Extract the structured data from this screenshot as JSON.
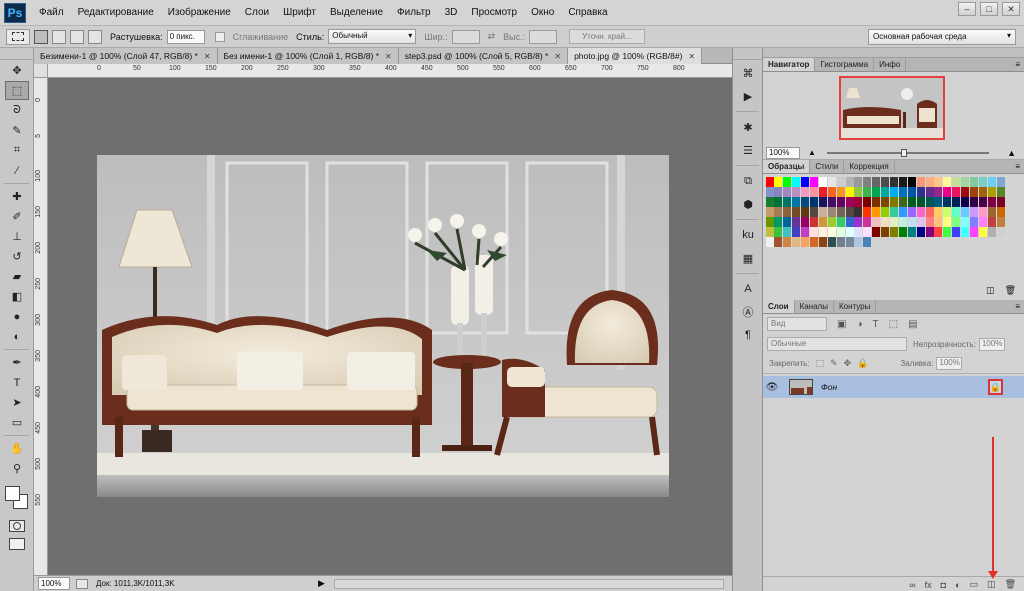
{
  "app": {
    "logo": "Ps"
  },
  "menu": [
    "Файл",
    "Редактирование",
    "Изображение",
    "Слои",
    "Шрифт",
    "Выделение",
    "Фильтр",
    "3D",
    "Просмотр",
    "Окно",
    "Справка"
  ],
  "window_controls": {
    "minimize": "–",
    "maximize": "□",
    "close": "✕"
  },
  "options": {
    "feather_label": "Растушевка:",
    "feather_value": "0 пикс.",
    "antialias_label": "Сглаживание",
    "style_label": "Стиль:",
    "style_value": "Обычный",
    "width_label": "Шир.:",
    "height_label": "Выс.:",
    "swap_icon": "⇄",
    "refine_label": "Уточн. край...",
    "workspace": "Основная рабочая среда"
  },
  "tools": [
    {
      "name": "move-icon",
      "glyph": "✥"
    },
    {
      "name": "marquee-icon",
      "glyph": "⬚"
    },
    {
      "name": "lasso-icon",
      "glyph": "ᘐ"
    },
    {
      "name": "quick-select-icon",
      "glyph": "✎"
    },
    {
      "name": "crop-icon",
      "glyph": "⌗"
    },
    {
      "name": "eyedropper-icon",
      "glyph": "⁄"
    },
    {
      "name": "healing-icon",
      "glyph": "✚"
    },
    {
      "name": "brush-icon",
      "glyph": "✐"
    },
    {
      "name": "stamp-icon",
      "glyph": "⊥"
    },
    {
      "name": "history-brush-icon",
      "glyph": "↺"
    },
    {
      "name": "eraser-icon",
      "glyph": "▰"
    },
    {
      "name": "gradient-icon",
      "glyph": "◧"
    },
    {
      "name": "blur-icon",
      "glyph": "●"
    },
    {
      "name": "dodge-icon",
      "glyph": "◐"
    },
    {
      "name": "pen-icon",
      "glyph": "✒"
    },
    {
      "name": "type-icon",
      "glyph": "T"
    },
    {
      "name": "path-select-icon",
      "glyph": "➤"
    },
    {
      "name": "shape-icon",
      "glyph": "▭"
    },
    {
      "name": "hand-icon",
      "glyph": "✋"
    },
    {
      "name": "zoom-icon",
      "glyph": "⚲"
    }
  ],
  "tabs": [
    {
      "label": "Безимени-1 @ 100% (Слой 47, RGB/8) *",
      "close": "✕",
      "active": false
    },
    {
      "label": "Без имени-1 @ 100% (Слой 1, RGB/8) *",
      "close": "✕",
      "active": false
    },
    {
      "label": "step3.psd @ 100% (Слой 5, RGB/8) *",
      "close": "✕",
      "active": false
    },
    {
      "label": "photo.jpg @ 100% (RGB/8#)",
      "close": "✕",
      "active": true
    }
  ],
  "ruler_h": [
    "0",
    "50",
    "100",
    "150",
    "200",
    "250",
    "300",
    "350",
    "400",
    "450",
    "500",
    "550",
    "600",
    "650",
    "700",
    "750",
    "800"
  ],
  "ruler_v": [
    "0",
    "5",
    "100",
    "150",
    "200",
    "250",
    "300",
    "350",
    "400",
    "450",
    "500",
    "550"
  ],
  "status": {
    "zoom": "100%",
    "doc": "Док: 1011,3K/1011,3K",
    "arrow": "▶"
  },
  "dock_icons": [
    {
      "name": "history-panel-icon",
      "glyph": "⌘"
    },
    {
      "name": "actions-panel-icon",
      "glyph": "▶"
    },
    {
      "name": "brush-preset-icon",
      "glyph": "✱"
    },
    {
      "name": "adjust-icon",
      "glyph": "☰"
    },
    {
      "name": "clone-source-icon",
      "glyph": "⧉"
    },
    {
      "name": "3d-icon",
      "glyph": "⬢"
    },
    {
      "name": "kuler-icon",
      "glyph": "ku"
    },
    {
      "name": "pattern-icon",
      "glyph": "▦"
    },
    {
      "name": "character-icon",
      "glyph": "A"
    },
    {
      "name": "paragraph-style-icon",
      "glyph": "Ⓐ"
    },
    {
      "name": "paragraph-icon",
      "glyph": "¶"
    }
  ],
  "navigator": {
    "tabs": [
      "Навигатор",
      "Гистограмма",
      "Инфо"
    ],
    "zoom": "100%",
    "small_mountain": "▲",
    "large_mountain": "▲",
    "menu": "≡"
  },
  "swatches": {
    "tabs": [
      "Образцы",
      "Стили",
      "Коррекция"
    ],
    "menu": "≡",
    "new_icon": "◫",
    "delete_icon": "🗑",
    "colors": [
      "#ff0000",
      "#ffff00",
      "#00ff00",
      "#00ffff",
      "#0000ff",
      "#ff00ff",
      "#ffffff",
      "#e6e6e6",
      "#cccccc",
      "#b3b3b3",
      "#999999",
      "#808080",
      "#666666",
      "#4d4d4d",
      "#333333",
      "#1a1a1a",
      "#000000",
      "#f7977a",
      "#f9ad81",
      "#fdc68a",
      "#fff79a",
      "#c4df9b",
      "#a2d39c",
      "#82ca9d",
      "#7bcdc8",
      "#6ecff6",
      "#7ea7d8",
      "#8493ca",
      "#8882be",
      "#a187be",
      "#bc8dbf",
      "#f49ac2",
      "#f6989d",
      "#ed1c24",
      "#f26522",
      "#f7941d",
      "#fff200",
      "#8dc63f",
      "#39b54a",
      "#00a651",
      "#00a99d",
      "#00aeef",
      "#0072bc",
      "#0054a6",
      "#2e3192",
      "#662d91",
      "#92278f",
      "#ec008c",
      "#ed145b",
      "#9e0b0f",
      "#a0410d",
      "#a36209",
      "#aba000",
      "#598527",
      "#197b30",
      "#007236",
      "#00746b",
      "#0076a3",
      "#004b80",
      "#003471",
      "#1b1464",
      "#440e62",
      "#630460",
      "#9e005d",
      "#9e0039",
      "#790000",
      "#7b2e00",
      "#7d4900",
      "#827b00",
      "#406618",
      "#005e20",
      "#005826",
      "#005952",
      "#005b7f",
      "#003663",
      "#002157",
      "#0d004c",
      "#32004b",
      "#4b0049",
      "#7b0046",
      "#7a0026",
      "#c69c6d",
      "#a67c52",
      "#8c6239",
      "#754c24",
      "#603913",
      "#534741",
      "#c7b299",
      "#998675",
      "#736357",
      "#534741",
      "#362f2d",
      "#ff3300",
      "#ff9900",
      "#99cc00",
      "#33cc99",
      "#3399ff",
      "#9966ff",
      "#ff66cc",
      "#ff6666",
      "#ffcc66",
      "#ccff66",
      "#66ffcc",
      "#66ccff",
      "#cc99ff",
      "#ff99cc",
      "#996633",
      "#cc6600",
      "#669900",
      "#009966",
      "#006699",
      "#663399",
      "#990066",
      "#cc3333",
      "#cc9933",
      "#99cc33",
      "#33cc66",
      "#3366cc",
      "#9933cc",
      "#cc3399",
      "#f0c0c0",
      "#f0e0c0",
      "#e0f0c0",
      "#c0f0e0",
      "#c0e0f0",
      "#e0c0f0",
      "#ff8080",
      "#ffc080",
      "#ffff80",
      "#80ff80",
      "#80ffff",
      "#8080ff",
      "#ff80ff",
      "#c04040",
      "#c08040",
      "#c0c040",
      "#40c040",
      "#40c0c0",
      "#4040c0",
      "#c040c0",
      "#ffe0e0",
      "#fff0e0",
      "#ffffe0",
      "#e0ffe0",
      "#e0ffff",
      "#e0e0ff",
      "#ffe0ff",
      "#800000",
      "#804000",
      "#808000",
      "#008000",
      "#008080",
      "#000080",
      "#800080",
      "#ff4040",
      "#40ff40",
      "#4040ff",
      "#40ffff",
      "#ff40ff",
      "#ffff40",
      "#b0b0b0",
      "#d0d0d0",
      "#f0f0f0",
      "#a0522d",
      "#cd853f",
      "#deb887",
      "#f4a460",
      "#d2691e",
      "#8b4513",
      "#2f4f4f",
      "#708090",
      "#778899",
      "#b0c4de",
      "#4682b4"
    ]
  },
  "layers": {
    "tabs": [
      "Слои",
      "Каналы",
      "Контуры"
    ],
    "menu": "≡",
    "filter_value": "Вид",
    "filter_icons": [
      "▣",
      "◑",
      "T",
      "⬚",
      "▤"
    ],
    "blend_value": "Обычные",
    "opacity_label": "Непрозрачность:",
    "opacity_value": "100%",
    "lock_label": "Закрепить:",
    "lock_icons": [
      "⬚",
      "✎",
      "✥",
      "🔒"
    ],
    "fill_label": "Заливка:",
    "fill_value": "100%",
    "layer_name": "Фон",
    "eye": "👁",
    "lock_glyph": "🔒",
    "footer_icons": [
      "∞",
      "fx",
      "◘",
      "◐",
      "▭",
      "◫",
      "🗑"
    ]
  }
}
